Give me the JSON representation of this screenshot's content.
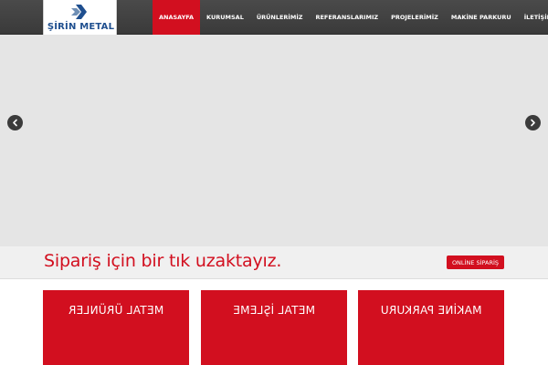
{
  "header": {
    "logo_text": "ŞİRİN METAL",
    "nav": [
      {
        "label": "ANASAYFA",
        "active": true
      },
      {
        "label": "KURUMSAL",
        "active": false
      },
      {
        "label": "ÜRÜNLERİMİZ",
        "active": false
      },
      {
        "label": "REFERANSLARIMIZ",
        "active": false
      },
      {
        "label": "PROJELERİMİZ",
        "active": false
      },
      {
        "label": "MAKİNE PARKURU",
        "active": false
      },
      {
        "label": "İLETİŞİM",
        "active": false
      }
    ]
  },
  "slider": {
    "prev_icon": "chevron-left-icon",
    "next_icon": "chevron-right-icon"
  },
  "cta": {
    "text": "Sipariş için bir tık uzaktayız.",
    "button_label": "ONLİNE SİPARİŞ"
  },
  "cards": [
    {
      "label": "METAL ÜRÜNLER"
    },
    {
      "label": "METAL İŞLEME"
    },
    {
      "label": "MAKİNE PARKURU"
    }
  ],
  "colors": {
    "accent": "#d20f1f",
    "header_bg": "#444444",
    "slider_bg": "#e5e5e5",
    "logo_blue": "#1f4f8f"
  }
}
